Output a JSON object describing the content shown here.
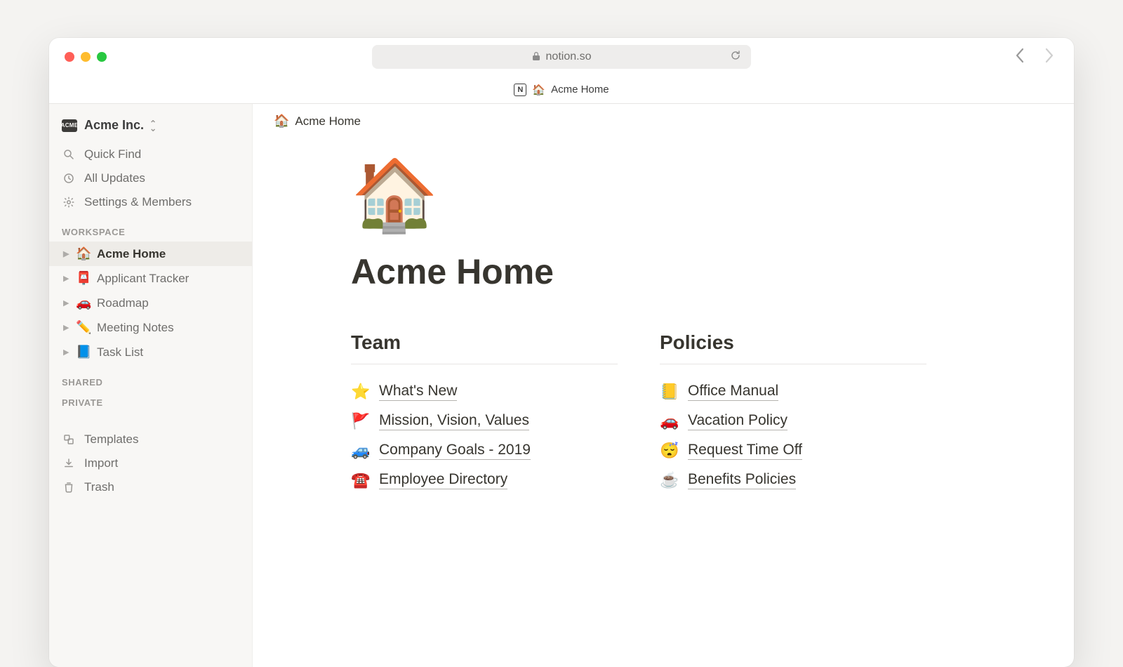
{
  "browser": {
    "url": "notion.so",
    "tab_emoji": "🏠",
    "tab_title": "Acme Home"
  },
  "sidebar": {
    "workspace_name": "Acme Inc.",
    "workspace_badge": "ACME",
    "quick_find": "Quick Find",
    "all_updates": "All Updates",
    "settings": "Settings & Members",
    "section_workspace": "WORKSPACE",
    "section_shared": "SHARED",
    "section_private": "PRIVATE",
    "pages": [
      {
        "emoji": "🏠",
        "label": "Acme Home",
        "active": true
      },
      {
        "emoji": "📮",
        "label": "Applicant Tracker"
      },
      {
        "emoji": "🚗",
        "label": "Roadmap"
      },
      {
        "emoji": "✏️",
        "label": "Meeting Notes"
      },
      {
        "emoji": "📘",
        "label": "Task List"
      }
    ],
    "templates": "Templates",
    "import": "Import",
    "trash": "Trash"
  },
  "breadcrumb": {
    "emoji": "🏠",
    "label": "Acme Home"
  },
  "page": {
    "hero_emoji": "🏠",
    "title": "Acme Home",
    "columns": [
      {
        "heading": "Team",
        "links": [
          {
            "emoji": "⭐",
            "label": "What's New"
          },
          {
            "emoji": "🚩",
            "label": "Mission, Vision, Values"
          },
          {
            "emoji": "🚙",
            "label": "Company Goals - 2019"
          },
          {
            "emoji": "☎️",
            "label": "Employee Directory"
          }
        ]
      },
      {
        "heading": "Policies",
        "links": [
          {
            "emoji": "📒",
            "label": "Office Manual"
          },
          {
            "emoji": "🚗",
            "label": "Vacation Policy"
          },
          {
            "emoji": "😴",
            "label": "Request Time Off"
          },
          {
            "emoji": "☕",
            "label": "Benefits Policies"
          }
        ]
      }
    ]
  }
}
